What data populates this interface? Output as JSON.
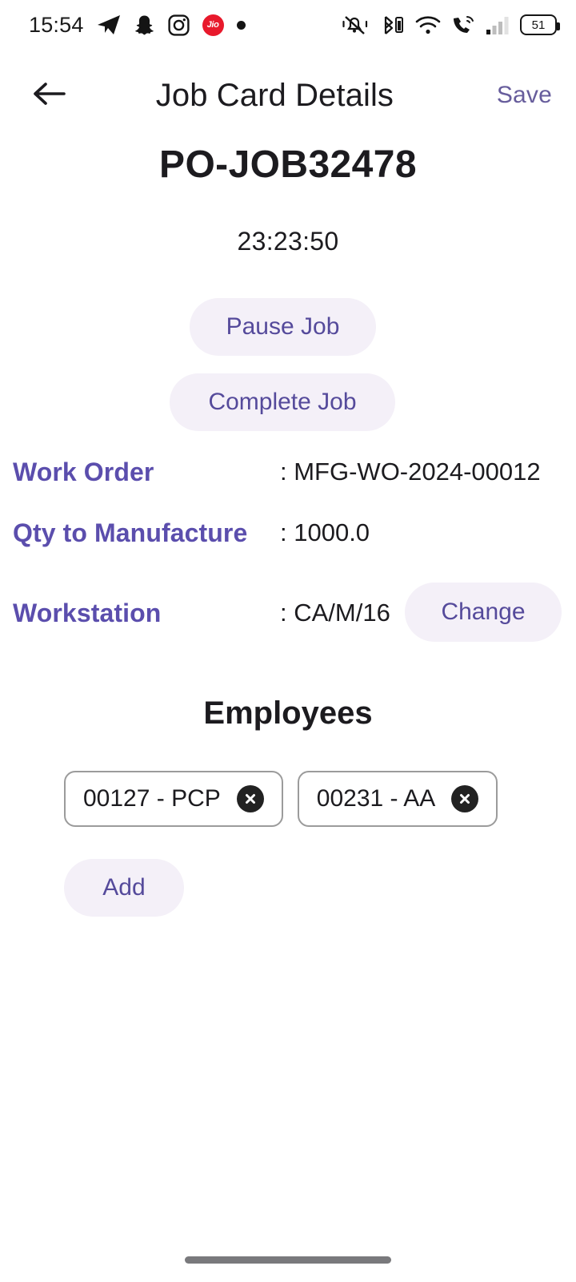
{
  "status_bar": {
    "time": "15:54",
    "left_icons": [
      "telegram-icon",
      "snapchat-icon",
      "instagram-icon",
      "jio-icon",
      "dot-indicator-icon"
    ],
    "jio_label": "Jio",
    "right_icons": [
      "vibrate-mute-icon",
      "bluetooth-battery-icon",
      "wifi-icon",
      "wifi-calling-icon",
      "cellular-signal-icon"
    ],
    "battery_level": "51"
  },
  "app_bar": {
    "back_icon": "back-arrow-icon",
    "title": "Job Card Details",
    "save_label": "Save"
  },
  "job": {
    "id": "PO-JOB32478",
    "timer": "23:23:50",
    "pause_label": "Pause Job",
    "complete_label": "Complete Job"
  },
  "details": [
    {
      "label": "Work Order",
      "separator": ": ",
      "value": "MFG-WO-2024-00012"
    },
    {
      "label": "Qty to Manufacture",
      "separator": ": ",
      "value": "1000.0"
    },
    {
      "label": "Workstation",
      "separator": ": ",
      "value": "CA/M/16"
    }
  ],
  "workstation_change_label": "Change",
  "employees": {
    "title": "Employees",
    "chips": [
      {
        "label": "00127 - PCP",
        "remove_icon": "close-circle-icon"
      },
      {
        "label": "00231 - AA",
        "remove_icon": "close-circle-icon"
      }
    ],
    "add_label": "Add"
  },
  "colors": {
    "accent_purple": "#5b4ead",
    "muted_purple": "#675d9c",
    "pill_background": "#f4f0f8",
    "text_dark": "#1c1b1f",
    "jio_red": "#e8192c",
    "chip_border": "#9b9b9b",
    "home_indicator": "#79797c"
  }
}
